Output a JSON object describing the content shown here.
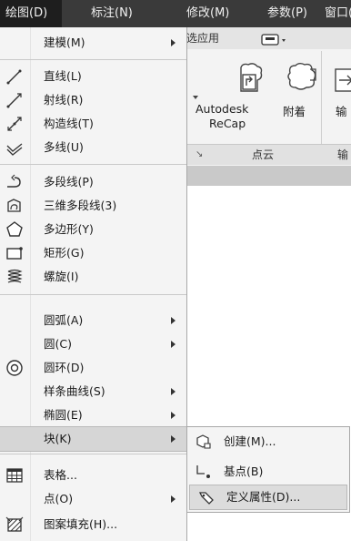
{
  "menubar": {
    "items": [
      {
        "label": "绘图(D)",
        "active": true
      },
      {
        "label": "标注(N)"
      },
      {
        "label": "修改(M)"
      },
      {
        "label": "参数(P)"
      },
      {
        "label": "窗口(W"
      }
    ]
  },
  "ribbon": {
    "quick_access_text": "选应用",
    "recap_label_line1": "Autodesk",
    "recap_label_line2": "ReCap",
    "attach_label": "附着",
    "input_partial": "输",
    "panel_title": "点云",
    "panel_title_partial": "输"
  },
  "draw_menu": {
    "items": [
      {
        "label": "建模(M)",
        "submenu": true,
        "icon": ""
      },
      {
        "label": "直线(L)",
        "icon": "line-icon"
      },
      {
        "label": "射线(R)",
        "icon": "ray-icon"
      },
      {
        "label": "构造线(T)",
        "icon": "construction-line-icon"
      },
      {
        "label": "多线(U)",
        "icon": "multiline-icon"
      },
      {
        "label": "多段线(P)",
        "icon": "polyline-icon"
      },
      {
        "label": "三维多段线(3)",
        "icon": "3d-polyline-icon"
      },
      {
        "label": "多边形(Y)",
        "icon": "polygon-icon"
      },
      {
        "label": "矩形(G)",
        "icon": "rectangle-icon"
      },
      {
        "label": "螺旋(I)",
        "icon": "helix-icon"
      },
      {
        "label": "圆弧(A)",
        "submenu": true
      },
      {
        "label": "圆(C)",
        "submenu": true
      },
      {
        "label": "圆环(D)",
        "icon": "donut-icon"
      },
      {
        "label": "样条曲线(S)",
        "submenu": true
      },
      {
        "label": "椭圆(E)",
        "submenu": true
      },
      {
        "label": "块(K)",
        "submenu": true,
        "highlighted": true
      },
      {
        "label": "表格...",
        "icon": "table-icon"
      },
      {
        "label": "点(O)",
        "submenu": true
      },
      {
        "label": "图案填充(H)...",
        "icon": "hatch-icon"
      }
    ]
  },
  "block_submenu": {
    "items": [
      {
        "label": "创建(M)...",
        "icon": "create-block-icon"
      },
      {
        "label": "基点(B)",
        "icon": "base-point-icon"
      },
      {
        "label": "定义属性(D)...",
        "icon": "define-attribute-icon",
        "highlighted": true
      }
    ]
  },
  "colors": {
    "menubar_bg": "#3a3a3a",
    "menu_bg": "#f4f4f4",
    "highlight_bg": "#d6d6d6"
  }
}
